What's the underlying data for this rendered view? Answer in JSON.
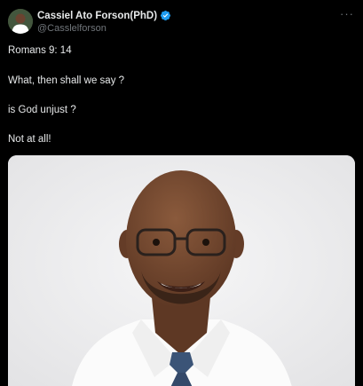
{
  "author": {
    "display_name": "Cassiel Ato Forson(PhD)",
    "handle": "@Casslelforson",
    "verified_icon": "verified-badge-icon",
    "avatar_icon": "avatar-photo"
  },
  "more_icon": "more-options-icon",
  "more_label": "···",
  "tweet": {
    "lines": [
      "Romans 9: 14",
      "What, then shall we say ?",
      "is God unjust ?",
      "Not at all!"
    ]
  },
  "media": {
    "type": "photo"
  },
  "colors": {
    "background": "#000000",
    "text": "#e7e9ea",
    "secondary": "#71767b",
    "verified": "#1d9bf0"
  }
}
